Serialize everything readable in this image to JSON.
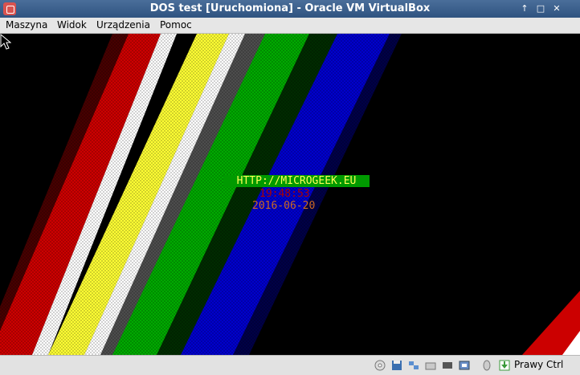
{
  "window": {
    "title": "DOS test [Uruchomiona] - Oracle VM VirtualBox",
    "controls": [
      "maximize-up-icon",
      "restore-icon",
      "close-icon"
    ]
  },
  "menu": [
    {
      "label": "Maszyna"
    },
    {
      "label": "Widok"
    },
    {
      "label": "Urządzenia"
    },
    {
      "label": "Pomoc"
    }
  ],
  "screen": {
    "url": "HTTP://MICROGEEK.EU",
    "time": "19:48:53",
    "date": "2016-06-20",
    "stripe_colors": [
      "#cc0000",
      "#ffffff",
      "#ffff33",
      "#ffffff",
      "#00aa00",
      "#0000cc"
    ]
  },
  "status": {
    "icons": [
      "optical-drive-icon",
      "floppy-icon",
      "network-icon",
      "shared-folder-icon",
      "display-icon",
      "video-capture-icon",
      "mouse-integration-icon",
      "keyboard-capture-icon"
    ],
    "host_key": "Prawy Ctrl"
  }
}
